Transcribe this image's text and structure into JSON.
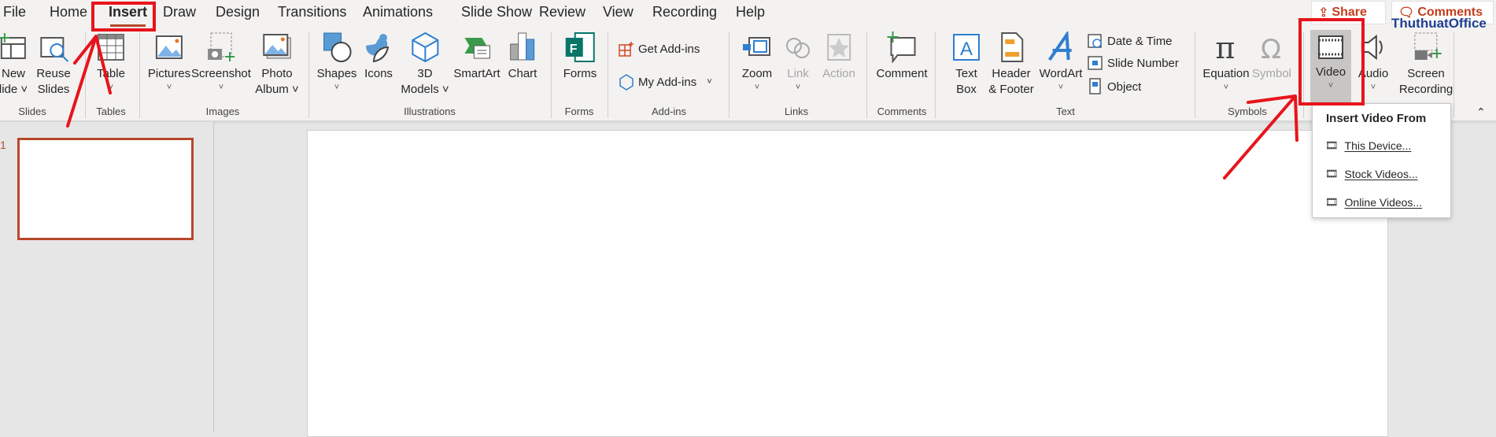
{
  "tabs": [
    "File",
    "Home",
    "Insert",
    "Draw",
    "Design",
    "Transitions",
    "Animations",
    "Slide Show",
    "Review",
    "View",
    "Recording",
    "Help"
  ],
  "active_tab": "Insert",
  "top_buttons": {
    "share": "Share",
    "comments": "Comments"
  },
  "watermark": "ThuthuatOffice",
  "ribbon": {
    "items": [
      {
        "l1": "New",
        "l2": "lide ˅"
      },
      {
        "l1": "Reuse",
        "l2": "Slides"
      },
      {
        "l1": "Table",
        "l2": "˅"
      },
      {
        "l1": "Pictures",
        "l2": "˅"
      },
      {
        "l1": "Screenshot",
        "l2": "˅"
      },
      {
        "l1": "Photo",
        "l2": "Album ˅"
      },
      {
        "l1": "Shapes",
        "l2": "˅"
      },
      {
        "l1": "Icons",
        "l2": ""
      },
      {
        "l1": "3D",
        "l2": "Models ˅"
      },
      {
        "l1": "SmartArt",
        "l2": ""
      },
      {
        "l1": "Chart",
        "l2": ""
      },
      {
        "l1": "Forms",
        "l2": ""
      },
      {
        "l1": "Zoom",
        "l2": "˅"
      },
      {
        "l1": "Link",
        "l2": "˅"
      },
      {
        "l1": "Action",
        "l2": ""
      },
      {
        "l1": "Comment",
        "l2": ""
      },
      {
        "l1": "Text",
        "l2": "Box"
      },
      {
        "l1": "Header",
        "l2": "& Footer"
      },
      {
        "l1": "WordArt",
        "l2": "˅"
      },
      {
        "l1": "Equation",
        "l2": "˅"
      },
      {
        "l1": "Symbol",
        "l2": ""
      },
      {
        "l1": "Video",
        "l2": "˅"
      },
      {
        "l1": "Audio",
        "l2": "˅"
      },
      {
        "l1": "Screen",
        "l2": "Recording"
      }
    ],
    "small": {
      "get_addins": "Get Add-ins",
      "my_addins": "My Add-ins",
      "date_time": "Date & Time",
      "slide_number": "Slide Number",
      "object": "Object"
    },
    "groups": [
      "Slides",
      "Tables",
      "Images",
      "Illustrations",
      "Forms",
      "Add-ins",
      "Links",
      "Comments",
      "Text",
      "Symbols"
    ]
  },
  "thumbnail_number": "1",
  "video_menu": {
    "header": "Insert Video From",
    "items": [
      "This Device...",
      "Stock Videos...",
      "Online Videos..."
    ]
  },
  "colors": {
    "accent": "#b7472a",
    "annotation": "#e8141c"
  }
}
